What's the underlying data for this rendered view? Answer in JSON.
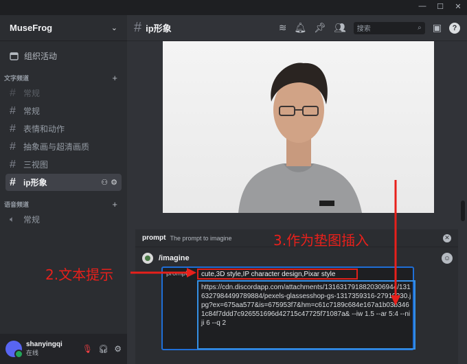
{
  "window": {
    "minimize": "—",
    "maximize": "☐",
    "close": "✕"
  },
  "server": {
    "name": "MuseFrog"
  },
  "sidebar": {
    "event_label": "组织活动",
    "text_category": "文字频道",
    "voice_category": "语音频道",
    "channels": [
      {
        "name": "常规",
        "muted": true
      },
      {
        "name": "常规",
        "muted": false
      },
      {
        "name": "表情和动作",
        "muted": false
      },
      {
        "name": "抽象画与超清画质",
        "muted": false
      },
      {
        "name": "三视图",
        "muted": false
      },
      {
        "name": "ip形象",
        "active": true
      }
    ],
    "voice_channels": [
      {
        "name": "常规"
      }
    ]
  },
  "user": {
    "name": "shanyingqi",
    "status": "在线"
  },
  "header": {
    "channel": "ip形象",
    "search_placeholder": "搜索"
  },
  "command": {
    "param_name": "prompt",
    "param_desc": "The prompt to imagine",
    "name": "/imagine",
    "option_label": "prompt",
    "text_prompt": "cute,3D style,IP character design,Pixar style",
    "image_prompt": "https://cdn.discordapp.com/attachments/1316317918820306944/1316327984499789884/pexels-glassesshop-gs-1317359316-27919230.jpg?ex=675aa577&is=675953f7&hm=c61c7189c684e167a1b03b3461c84f7ddd7c926551696d42715c47725f71087a& --iw 1.5 --ar 5:4 --niji 6 --q 2"
  },
  "annotations": {
    "text_hint": "2.文本提示",
    "image_hint": "3.作为垫图插入"
  },
  "colors": {
    "accent_red": "#e8201b",
    "box_blue": "#3590e6",
    "online": "#23a55a"
  }
}
